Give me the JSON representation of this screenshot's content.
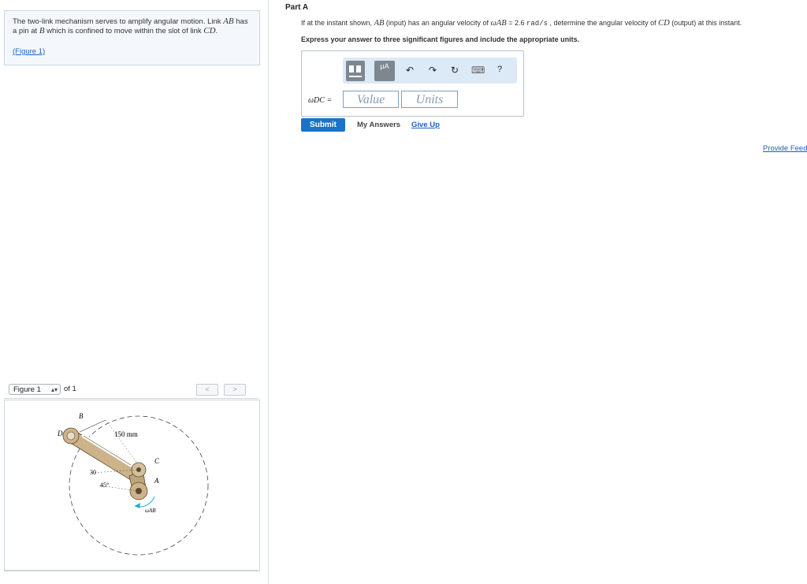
{
  "problem": {
    "text_part1": "The two-link mechanism serves to amplify angular motion. Link ",
    "link_ab": "AB",
    "text_part2": " has a pin at ",
    "pin_b": "B",
    "text_part3": " which is confined to move within the slot of link ",
    "link_cd": "CD",
    "text_part4": ".",
    "figure_link": "(Figure 1)"
  },
  "figure_nav": {
    "selected": "Figure 1",
    "of_label": "of 1",
    "prev": "<",
    "next": ">"
  },
  "figure": {
    "label_b": "B",
    "label_d": "D",
    "label_c": "C",
    "label_a": "A",
    "dimension": "150 mm",
    "angle_30": "30",
    "angle_45": "45°",
    "omega_ab": "ωAB"
  },
  "part": {
    "title": "Part A",
    "question_1": "If at the instant shown, ",
    "question_ab": "AB",
    "question_2": " (input) has an angular velocity of ",
    "question_omega": "ωAB",
    "question_3": " = 2.6 ",
    "question_units": "rad/s",
    "question_4": " , determine the angular velocity of ",
    "question_cd": "CD",
    "question_5": " (output) at this instant.",
    "instruction": "Express your answer to three significant figures and include the appropriate units."
  },
  "answer": {
    "variable_label": "ωDC =",
    "value_placeholder": "Value",
    "units_placeholder": "Units",
    "toolbar": {
      "templates_label": "",
      "units_label": "μA",
      "undo": "↶",
      "redo": "↷",
      "reset": "↻",
      "keyboard": "⌨",
      "help": "?"
    }
  },
  "actions": {
    "submit": "Submit",
    "my_answers": "My Answers",
    "give_up": "Give Up",
    "feedback": "Provide Feedback"
  }
}
